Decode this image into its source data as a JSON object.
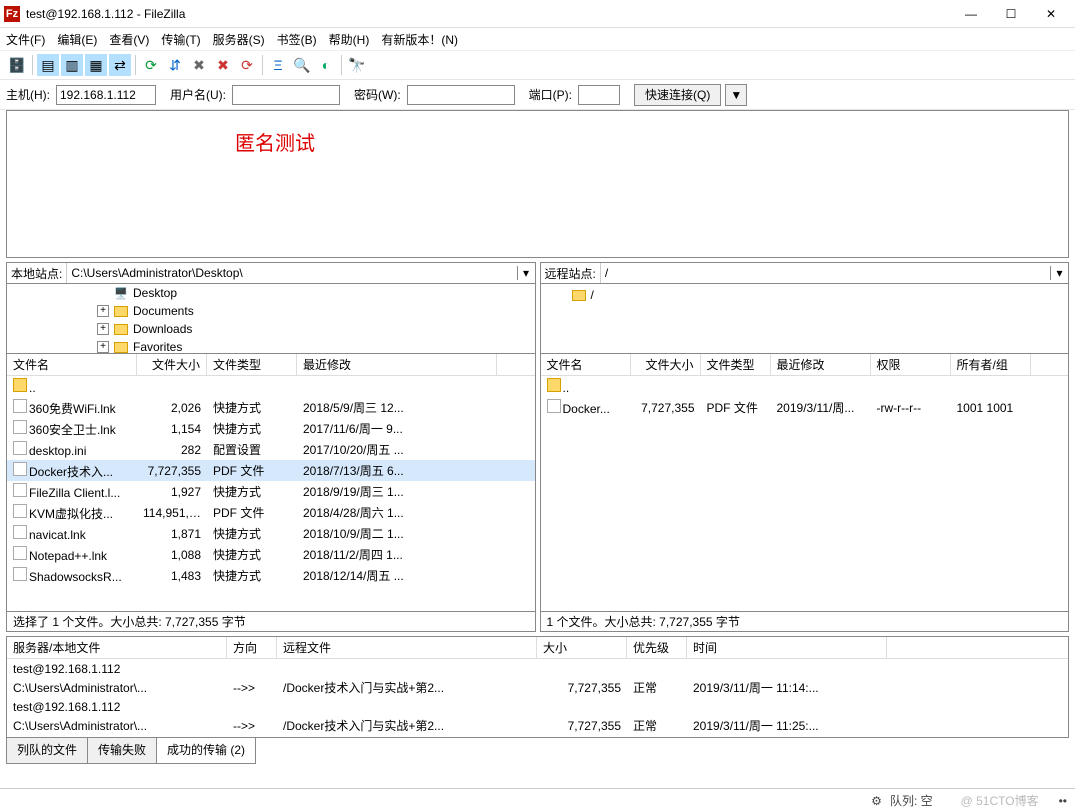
{
  "window": {
    "app_icon_text": "Fz",
    "title": "test@192.168.1.112 - FileZilla"
  },
  "menu": [
    "文件(F)",
    "编辑(E)",
    "查看(V)",
    "传输(T)",
    "服务器(S)",
    "书签(B)",
    "帮助(H)",
    "有新版本！(N)"
  ],
  "quick": {
    "host_label": "主机(H):",
    "host_value": "192.168.1.112",
    "user_label": "用户名(U):",
    "user_value": "",
    "pass_label": "密码(W):",
    "pass_value": "",
    "port_label": "端口(P):",
    "port_value": "",
    "connect_label": "快速连接(Q)",
    "connect_arrow": "▼"
  },
  "log": {
    "annotation": "匿名测试"
  },
  "local": {
    "site_label": "本地站点:",
    "path": "C:\\Users\\Administrator\\Desktop\\",
    "tree": [
      {
        "expander": "",
        "icon": "desktop",
        "name": "Desktop"
      },
      {
        "expander": "+",
        "icon": "folder",
        "name": "Documents"
      },
      {
        "expander": "+",
        "icon": "folder",
        "name": "Downloads"
      },
      {
        "expander": "+",
        "icon": "folder",
        "name": "Favorites"
      }
    ],
    "columns": [
      "文件名",
      "文件大小",
      "文件类型",
      "最近修改"
    ],
    "files": [
      {
        "name": "..",
        "size": "",
        "type": "",
        "mtime": ""
      },
      {
        "name": "360免费WiFi.lnk",
        "size": "2,026",
        "type": "快捷方式",
        "mtime": "2018/5/9/周三 12..."
      },
      {
        "name": "360安全卫士.lnk",
        "size": "1,154",
        "type": "快捷方式",
        "mtime": "2017/11/6/周一 9..."
      },
      {
        "name": "desktop.ini",
        "size": "282",
        "type": "配置设置",
        "mtime": "2017/10/20/周五 ..."
      },
      {
        "name": "Docker技术入...",
        "size": "7,727,355",
        "type": "PDF 文件",
        "mtime": "2018/7/13/周五 6...",
        "sel": true
      },
      {
        "name": "FileZilla Client.l...",
        "size": "1,927",
        "type": "快捷方式",
        "mtime": "2018/9/19/周三 1..."
      },
      {
        "name": "KVM虚拟化技...",
        "size": "114,951,5...",
        "type": "PDF 文件",
        "mtime": "2018/4/28/周六 1..."
      },
      {
        "name": "navicat.lnk",
        "size": "1,871",
        "type": "快捷方式",
        "mtime": "2018/10/9/周二 1..."
      },
      {
        "name": "Notepad++.lnk",
        "size": "1,088",
        "type": "快捷方式",
        "mtime": "2018/11/2/周四 1..."
      },
      {
        "name": "ShadowsocksR...",
        "size": "1,483",
        "type": "快捷方式",
        "mtime": "2018/12/14/周五 ..."
      }
    ],
    "status": "选择了 1 个文件。大小总共: 7,727,355 字节"
  },
  "remote": {
    "site_label": "远程站点:",
    "path": "/",
    "tree": [
      {
        "expander": "",
        "icon": "folder",
        "name": "/"
      }
    ],
    "columns": [
      "文件名",
      "文件大小",
      "文件类型",
      "最近修改",
      "权限",
      "所有者/组"
    ],
    "files": [
      {
        "name": "..",
        "size": "",
        "type": "",
        "mtime": "",
        "perm": "",
        "owner": ""
      },
      {
        "name": "Docker...",
        "size": "7,727,355",
        "type": "PDF 文件",
        "mtime": "2019/3/11/周...",
        "perm": "-rw-r--r--",
        "owner": "1001 1001"
      }
    ],
    "status": "1 个文件。大小总共: 7,727,355 字节"
  },
  "queue": {
    "columns": [
      "服务器/本地文件",
      "方向",
      "远程文件",
      "大小",
      "优先级",
      "时间"
    ],
    "rows": [
      {
        "server": "test@192.168.1.112",
        "dir": "",
        "remote": "",
        "size": "",
        "prio": "",
        "time": ""
      },
      {
        "server": "  C:\\Users\\Administrator\\...",
        "dir": "-->>",
        "remote": "/Docker技术入门与实战+第2...",
        "size": "7,727,355",
        "prio": "正常",
        "time": "2019/3/11/周一 11:14:..."
      },
      {
        "server": "test@192.168.1.112",
        "dir": "",
        "remote": "",
        "size": "",
        "prio": "",
        "time": ""
      },
      {
        "server": "  C:\\Users\\Administrator\\...",
        "dir": "-->>",
        "remote": "/Docker技术入门与实战+第2...",
        "size": "7,727,355",
        "prio": "正常",
        "time": "2019/3/11/周一 11:25:..."
      }
    ]
  },
  "tabs": [
    {
      "label": "列队的文件",
      "active": false
    },
    {
      "label": "传输失败",
      "active": false
    },
    {
      "label": "成功的传输 (2)",
      "active": true
    }
  ],
  "statusbar": {
    "queue_label": "队列: 空"
  },
  "watermark": "@ 51CTO博客"
}
